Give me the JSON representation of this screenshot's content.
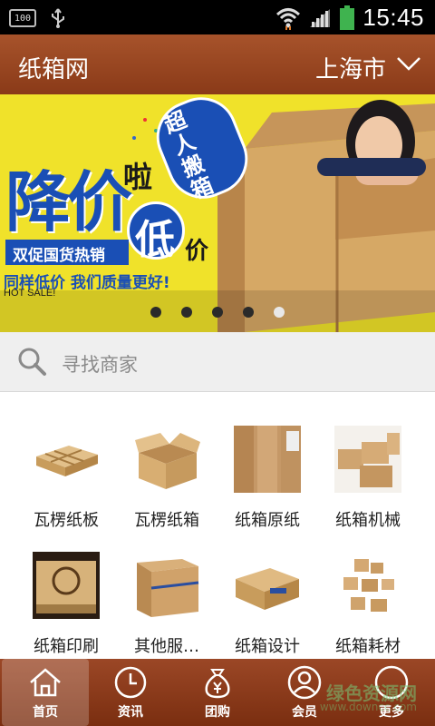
{
  "status_bar": {
    "battery_small": "100",
    "time": "15:45"
  },
  "header": {
    "title": "纸箱网",
    "city": "上海市"
  },
  "banner": {
    "headline": "降价",
    "headline_suffix": "啦",
    "badge_text": "超人搬箱",
    "low": "低",
    "price": "价",
    "ribbon": "双促国货热销",
    "slogan": "同样低价 我们质量更好!",
    "hot_sale": "HOT SALE!",
    "page_count": 5,
    "active_page": 4
  },
  "search": {
    "placeholder": "寻找商家"
  },
  "categories": [
    {
      "label": "瓦楞纸板",
      "icon": "corrugated-board-icon"
    },
    {
      "label": "瓦楞纸箱",
      "icon": "corrugated-box-icon"
    },
    {
      "label": "纸箱原纸",
      "icon": "paper-roll-icon"
    },
    {
      "label": "纸箱机械",
      "icon": "box-machine-icon"
    },
    {
      "label": "纸箱印刷",
      "icon": "printed-box-icon"
    },
    {
      "label": "其他服…",
      "icon": "other-service-icon"
    },
    {
      "label": "纸箱设计",
      "icon": "box-design-icon"
    },
    {
      "label": "纸箱耗材",
      "icon": "box-supplies-icon"
    }
  ],
  "tabs": [
    {
      "label": "首页",
      "icon": "home-icon"
    },
    {
      "label": "资讯",
      "icon": "clock-icon"
    },
    {
      "label": "团购",
      "icon": "money-bag-icon"
    },
    {
      "label": "会员",
      "icon": "user-icon"
    },
    {
      "label": "更多",
      "icon": "more-icon"
    }
  ],
  "watermark": {
    "text": "绿色资源网",
    "url": "www.downcc.com"
  },
  "colors": {
    "brand": "#8a3a18",
    "banner_bg": "#f0e22a",
    "headline_blue": "#1a4fb5"
  }
}
